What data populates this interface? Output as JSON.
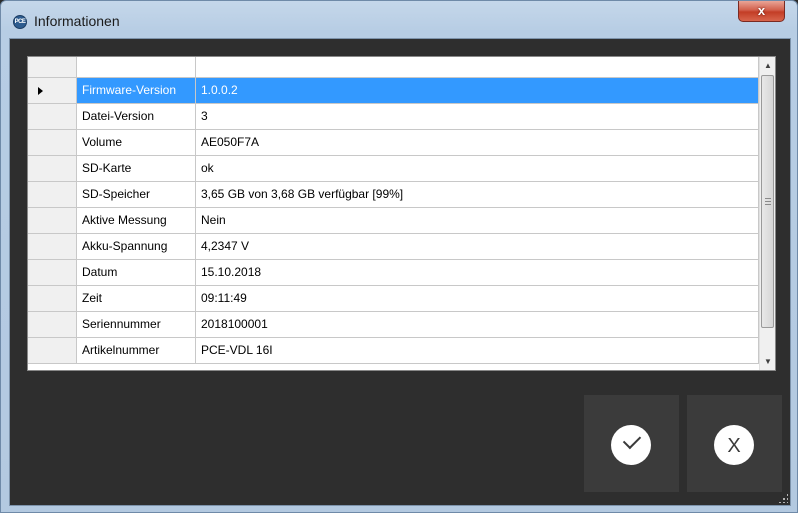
{
  "window": {
    "title": "Informationen",
    "app_icon_text": "PCE",
    "close_label": "x"
  },
  "grid": {
    "header": {
      "col_name": "",
      "col_value": ""
    },
    "rows": [
      {
        "name": "Firmware-Version",
        "value": "1.0.0.2",
        "selected": true
      },
      {
        "name": "Datei-Version",
        "value": "3"
      },
      {
        "name": "Volume",
        "value": "AE050F7A"
      },
      {
        "name": "SD-Karte",
        "value": "ok"
      },
      {
        "name": "SD-Speicher",
        "value": "3,65 GB von 3,68 GB verfügbar [99%]"
      },
      {
        "name": "Aktive Messung",
        "value": "Nein"
      },
      {
        "name": "Akku-Spannung",
        "value": "4,2347 V"
      },
      {
        "name": "Datum",
        "value": "15.10.2018"
      },
      {
        "name": "Zeit",
        "value": "09:11:49"
      },
      {
        "name": "Seriennummer",
        "value": "2018100001"
      },
      {
        "name": "Artikelnummer",
        "value": "PCE-VDL 16I"
      }
    ]
  },
  "scrollbar": {
    "up_glyph": "▲",
    "down_glyph": "▼"
  },
  "buttons": {
    "ok_icon": "check-icon",
    "cancel_label": "X"
  },
  "colors": {
    "selection": "#3399ff",
    "background": "#2e2e2e",
    "button": "#3b3b3b"
  }
}
